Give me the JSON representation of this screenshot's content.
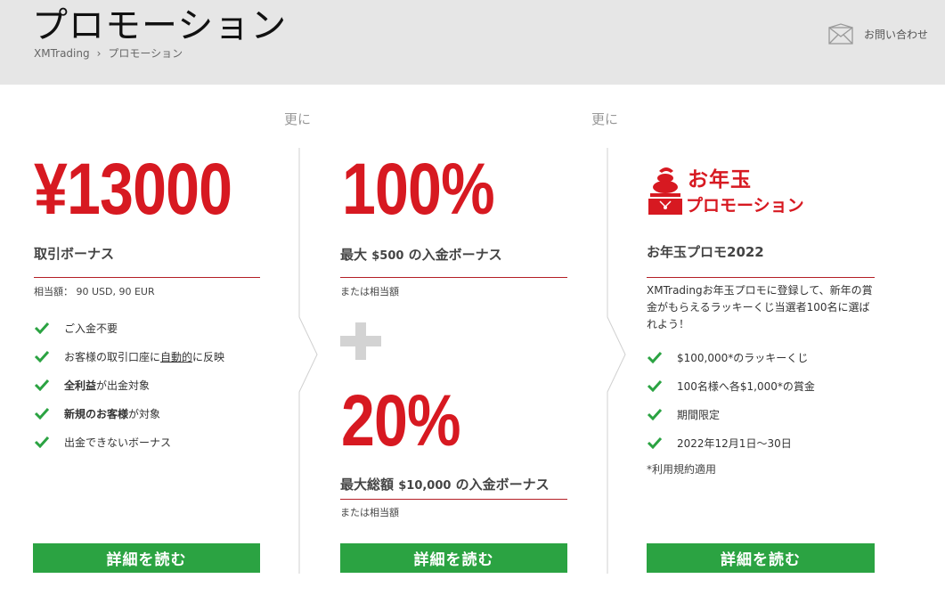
{
  "header": {
    "title": "プロモーション",
    "breadcrumb": {
      "home": "XMTrading",
      "separator": "›",
      "current": "プロモーション"
    },
    "contact_label": "お問い合わせ",
    "contact_icon": "envelope-icon"
  },
  "sarani": [
    "更に",
    "更に"
  ],
  "col1": {
    "amount": "¥13000",
    "subtitle": "取引ボーナス",
    "note": "相当額： 90 USD, 90 EUR",
    "items": [
      {
        "pre": "ご入金不要",
        "bold": "",
        "post": ""
      },
      {
        "pre": "お客様の取引口座に",
        "underline": "自動的",
        "post": "に反映"
      },
      {
        "pre": "",
        "bold": "全利益",
        "post": "が出金対象"
      },
      {
        "pre": "",
        "bold": "新規のお客様",
        "post": "が対象"
      },
      {
        "pre": "出金できないボーナス",
        "bold": "",
        "post": ""
      }
    ],
    "button": "詳細を読む"
  },
  "col2": {
    "pct1": "100%",
    "subtitle1_pre": "最大 ",
    "subtitle1_amt": "$500",
    "subtitle1_post": " の入金ボーナス",
    "note1": "または相当額",
    "pct2": "20%",
    "subtitle2_pre": "最大総額 ",
    "subtitle2_amt": "$10,000",
    "subtitle2_post": " の入金ボーナス",
    "note2": "または相当額",
    "button": "詳細を読む"
  },
  "col3": {
    "logo_line1": "お年玉",
    "logo_line2": "プロモーション",
    "subtitle": "お年玉プロモ2022",
    "description": "XMTradingお年玉プロモに登録して、新年の賞金がもらえるラッキーくじ当選者100名に選ばれよう！",
    "items": [
      "$100,000*のラッキーくじ",
      "100名様へ各$1,000*の賞金",
      "期間限定",
      "2022年12月1日～30日"
    ],
    "terms": "*利用規約適用",
    "button": "詳細を読む"
  },
  "colors": {
    "red": "#d71921",
    "green": "#2ba342",
    "header_bg": "#e6e6e6"
  }
}
